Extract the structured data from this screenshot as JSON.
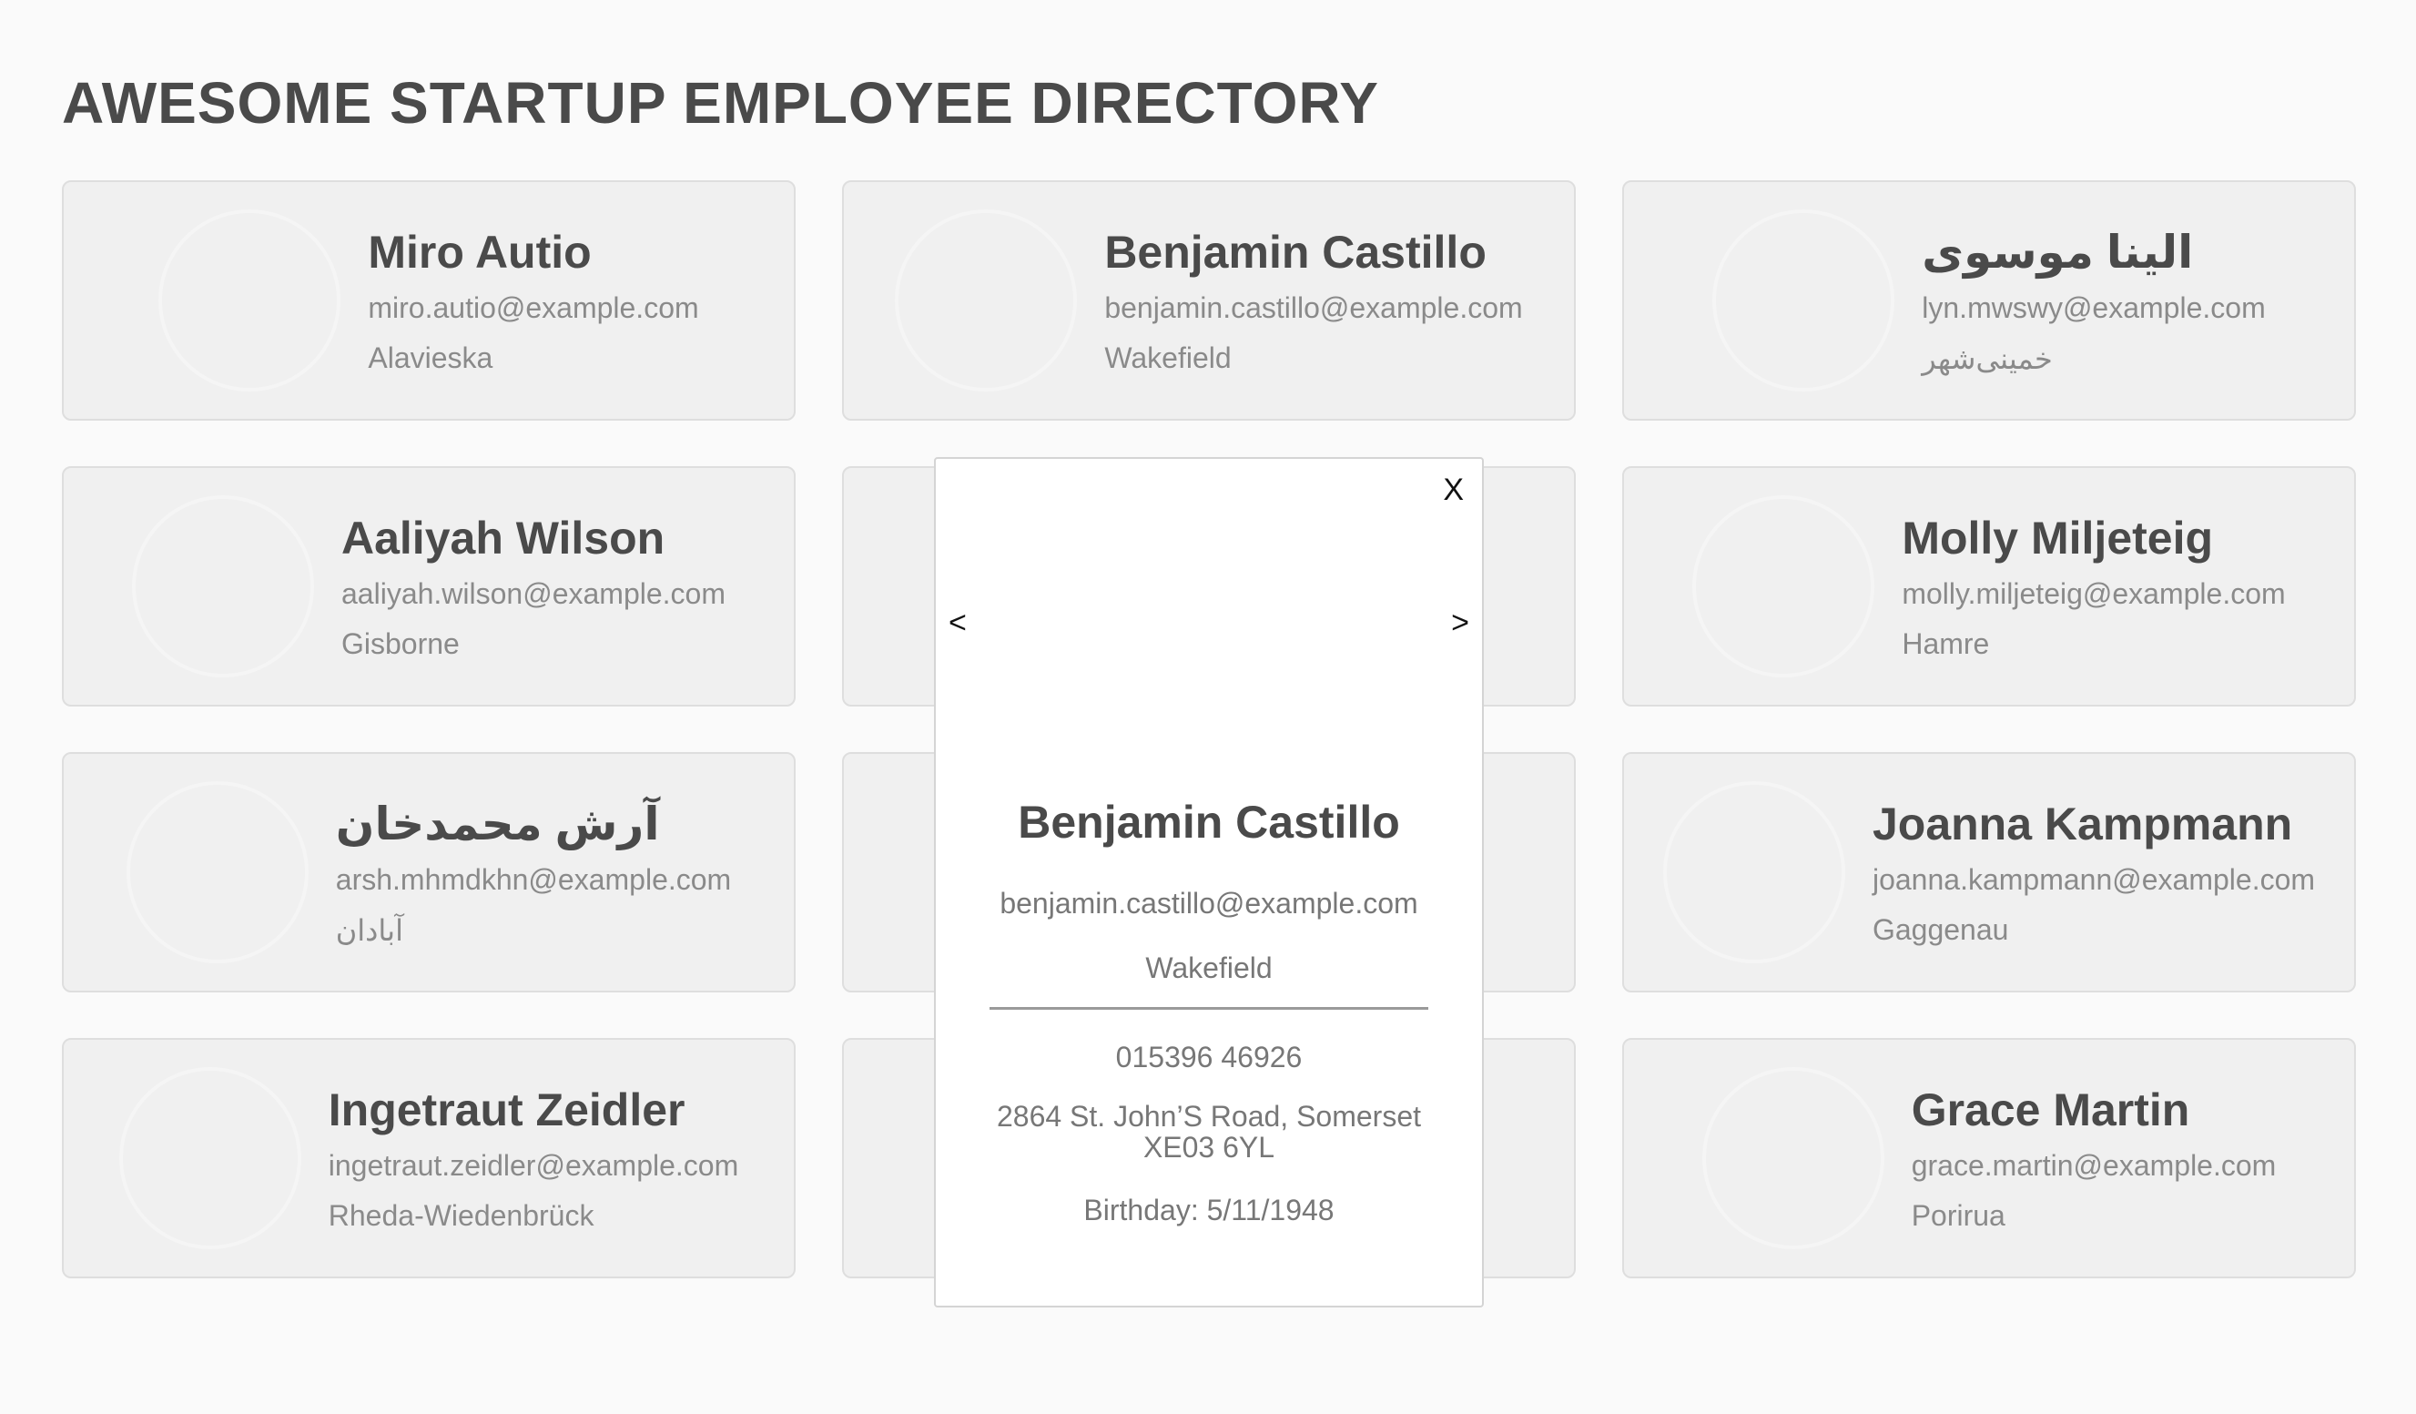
{
  "page": {
    "title": "AWESOME STARTUP EMPLOYEE DIRECTORY"
  },
  "employees": [
    {
      "name": "Miro Autio",
      "email": "miro.autio@example.com",
      "city": "Alavieska",
      "rtl": false,
      "photo_colors": [
        "#f4efe8",
        "#d9a37c",
        "#2b2522"
      ]
    },
    {
      "name": "Benjamin Castillo",
      "email": "benjamin.castillo@example.com",
      "city": "Wakefield",
      "rtl": false,
      "photo_colors": [
        "#e8e2dc",
        "#d8ad92",
        "#3b3a42"
      ]
    },
    {
      "name": "الینا موسوی",
      "email": "lyn.mwswy@example.com",
      "city": "خمینی‌شهر",
      "rtl": true,
      "photo_colors": [
        "#f2ede8",
        "#e6c0a8",
        "#7a4e38"
      ]
    },
    {
      "name": "Aaliyah Wilson",
      "email": "aaliyah.wilson@example.com",
      "city": "Gisborne",
      "rtl": false,
      "photo_colors": [
        "#3a2a2c",
        "#c8906e",
        "#d3503a"
      ]
    },
    {
      "name": "",
      "email": "",
      "city": "",
      "rtl": false,
      "photo_colors": [
        "#f3dcd2",
        "#e3b8a8",
        "#c79a8a"
      ]
    },
    {
      "name": "Molly Miljeteig",
      "email": "molly.miljeteig@example.com",
      "city": "Hamre",
      "rtl": false,
      "photo_colors": [
        "#f6f5f0",
        "#ecd3c0",
        "#1e1b1b"
      ]
    },
    {
      "name": "آرش محمدخان",
      "email": "arsh.mhmdkhn@example.com",
      "city": "آبادان",
      "rtl": true,
      "photo_colors": [
        "#eeeeec",
        "#c79a7c",
        "#2a2623"
      ]
    },
    {
      "name": "",
      "email": "",
      "city": "",
      "rtl": false,
      "photo_colors": [
        "#d8d8d8",
        "#9a9a9a",
        "#2a2a2a"
      ]
    },
    {
      "name": "Joanna Kampmann",
      "email": "joanna.kampmann@example.com",
      "city": "Gaggenau",
      "rtl": false,
      "photo_colors": [
        "#9a8b82",
        "#e0b89a",
        "#f2e4d6"
      ]
    },
    {
      "name": "Ingetraut Zeidler",
      "email": "ingetraut.zeidler@example.com",
      "city": "Rheda-Wiedenbrück",
      "rtl": false,
      "photo_colors": [
        "#e8d8c6",
        "#c48e74",
        "#3b2622"
      ]
    },
    {
      "name": "",
      "email": "",
      "city": "",
      "rtl": false,
      "photo_colors": [
        "#f0f0f0",
        "#f0f0f0",
        "#f0f0f0"
      ]
    },
    {
      "name": "Grace Martin",
      "email": "grace.martin@example.com",
      "city": "Porirua",
      "rtl": false,
      "photo_colors": [
        "#4e4a44",
        "#d9b69e",
        "#27325c"
      ]
    }
  ],
  "modal": {
    "close_label": "X",
    "prev_label": "<",
    "next_label": ">",
    "name": "Benjamin Castillo",
    "email": "benjamin.castillo@example.com",
    "city": "Wakefield",
    "phone": "015396 46926",
    "address": "2864 St. John’S Road, Somerset XE03 6YL",
    "birthday": "Birthday: 5/11/1948",
    "photo_colors": [
      "#e8e2dc",
      "#d8ad92",
      "#3b3a42"
    ]
  },
  "colors": {
    "background": "#fafafa",
    "card": "#f0f0f0",
    "card_border": "#dedede",
    "heading": "#4a4a4a",
    "muted_text": "#8a8a8a"
  }
}
